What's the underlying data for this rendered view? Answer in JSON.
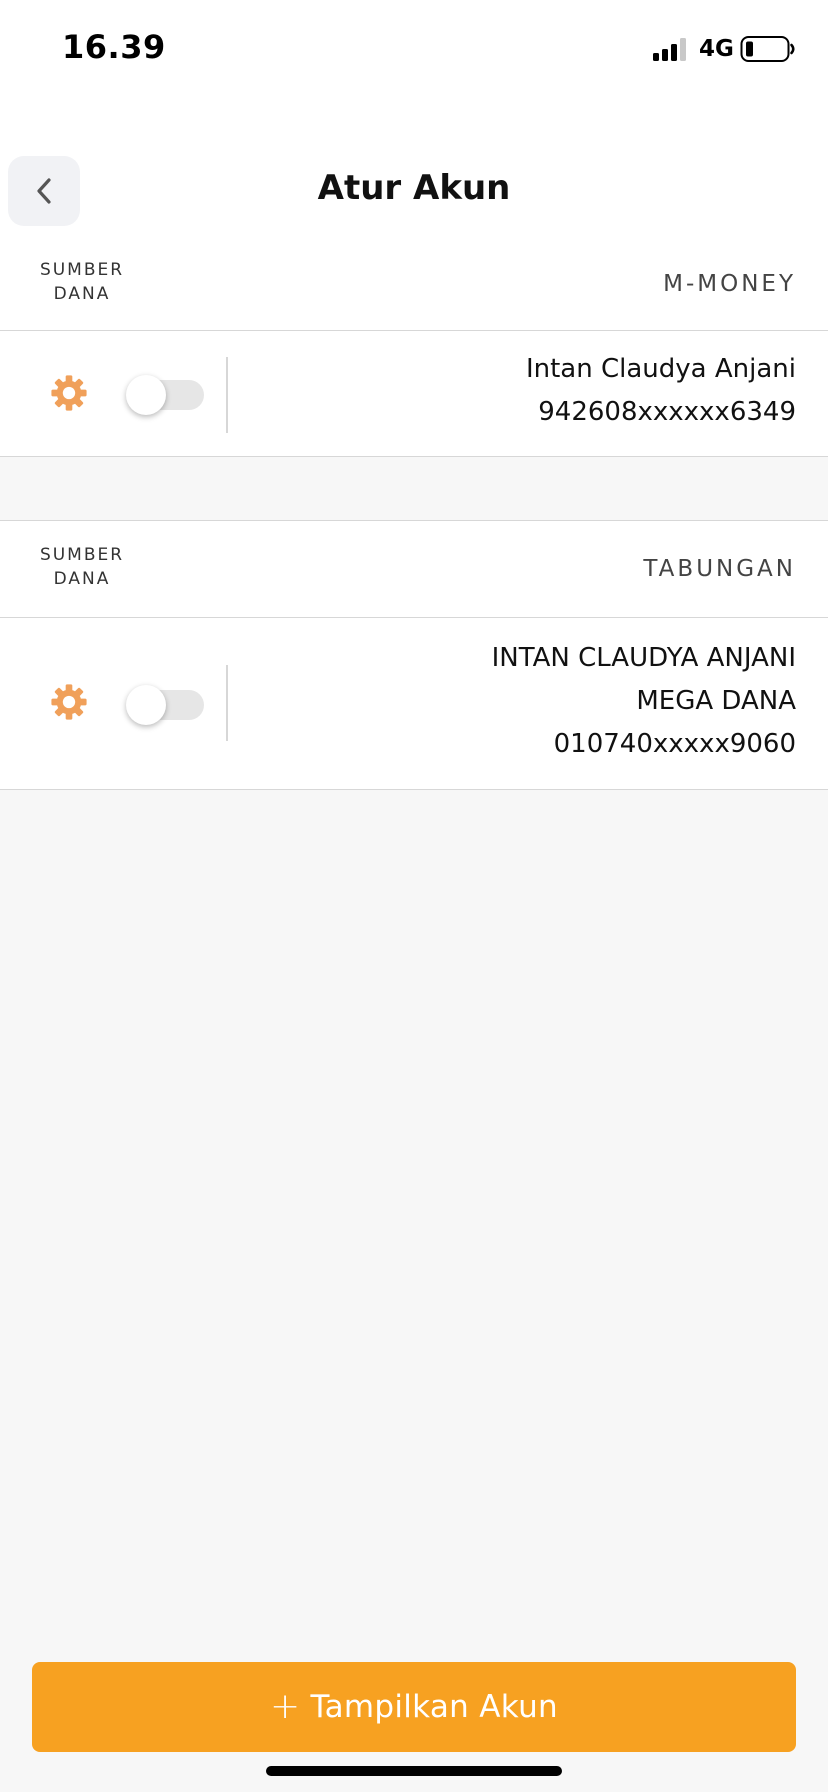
{
  "status_bar": {
    "time": "16.39",
    "network": "4G",
    "signal_icon": "cellular-signal-icon",
    "battery_icon": "battery-low-icon"
  },
  "header": {
    "back_icon": "chevron-left-icon",
    "title": "Atur Akun"
  },
  "accounts": [
    {
      "source_label_line1": "SUMBER",
      "source_label_line2": "DANA",
      "type": "M-MONEY",
      "enabled": false,
      "settings_icon": "gear-icon",
      "lines": [
        "Intan Claudya Anjani",
        "942608xxxxxx6349"
      ]
    },
    {
      "source_label_line1": "SUMBER",
      "source_label_line2": "DANA",
      "type": "TABUNGAN",
      "enabled": false,
      "settings_icon": "gear-icon",
      "lines": [
        "INTAN CLAUDYA ANJANI",
        "MEGA DANA",
        "010740xxxxx9060"
      ]
    }
  ],
  "footer": {
    "button_icon": "plus-icon",
    "button_label": "Tampilkan Akun"
  },
  "colors": {
    "accent": "#f7a121",
    "gear": "#f0a05a",
    "background": "#f7f7f7"
  }
}
